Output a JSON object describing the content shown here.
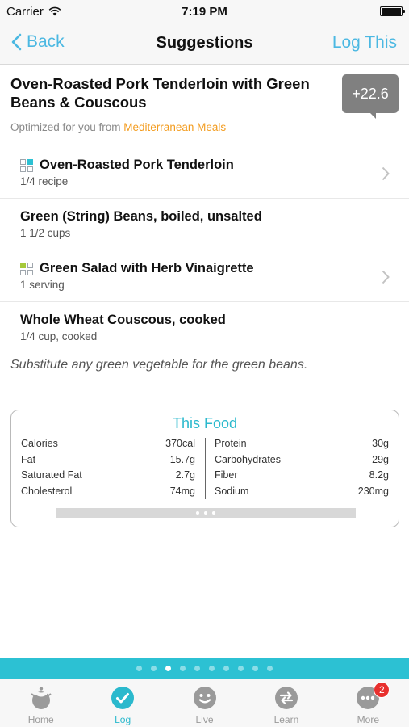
{
  "status_bar": {
    "carrier": "Carrier",
    "time": "7:19 PM"
  },
  "nav": {
    "back_label": "Back",
    "title": "Suggestions",
    "action_label": "Log This"
  },
  "meal": {
    "title": "Oven-Roasted Pork Tenderloin with Green Beans & Couscous",
    "score": "+22.6",
    "optimized_prefix": "Optimized for you from ",
    "optimized_source": "Mediterranean Meals"
  },
  "foods": [
    {
      "name": "Oven-Roasted Pork Tenderloin",
      "amount": "1/4 recipe",
      "icon": "recipe-teal-icon",
      "has_chevron": true
    },
    {
      "name": "Green (String) Beans, boiled, unsalted",
      "amount": "1 1/2 cups",
      "icon": "",
      "has_chevron": false
    },
    {
      "name": "Green Salad with Herb Vinaigrette",
      "amount": "1 serving",
      "icon": "recipe-green-icon",
      "has_chevron": true
    },
    {
      "name": "Whole Wheat Couscous, cooked",
      "amount": "1/4 cup, cooked",
      "icon": "",
      "has_chevron": false
    }
  ],
  "note": "Substitute any green vegetable for the green beans.",
  "nutrition": {
    "title": "This Food",
    "left": [
      {
        "label": "Calories",
        "value": "370cal"
      },
      {
        "label": "Fat",
        "value": "15.7g"
      },
      {
        "label": "Saturated Fat",
        "value": "2.7g"
      },
      {
        "label": "Cholesterol",
        "value": "74mg"
      }
    ],
    "right": [
      {
        "label": "Protein",
        "value": "30g"
      },
      {
        "label": "Carbohydrates",
        "value": "29g"
      },
      {
        "label": "Fiber",
        "value": "8.2g"
      },
      {
        "label": "Sodium",
        "value": "230mg"
      }
    ]
  },
  "page_indicator": {
    "count": 10,
    "active_index": 2
  },
  "tabs": [
    {
      "label": "Home",
      "icon": "home-icon"
    },
    {
      "label": "Log",
      "icon": "check-icon",
      "active": true
    },
    {
      "label": "Live",
      "icon": "smile-icon"
    },
    {
      "label": "Learn",
      "icon": "sync-icon"
    },
    {
      "label": "More",
      "icon": "more-icon",
      "badge": "2"
    }
  ],
  "colors": {
    "accent": "#2bb9cd",
    "link": "#4bb8e2",
    "source": "#f39c1f",
    "badge": "#e8302e",
    "score_badge": "#808080"
  }
}
